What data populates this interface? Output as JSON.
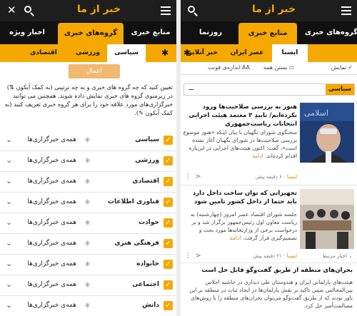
{
  "app": {
    "logo": "خبر از ما"
  },
  "left": {
    "tabs": [
      {
        "label": "منابع خبری"
      },
      {
        "label": "گروه‌های خبری",
        "active": true
      },
      {
        "label": "اخبار ویژه"
      }
    ],
    "subtabs": [
      {
        "label": "سیاسی"
      },
      {
        "label": "ورزشی"
      },
      {
        "label": "اقتصادی"
      }
    ],
    "apply_label": "اعمال",
    "instructions": "تعیین کنید که چه گروه های خبری و به چه ترتیبی (به کمک آیکون ⇅) در زیرمنوی گروه های خبری نمایش داده شوند. همچنین می توانید خبرگزاری‌های مورد علاقه خود را برای هر گروه خبری تعریف کنید (به کمک آیکون ✎).",
    "categories": [
      {
        "name": "سیاسی",
        "sources": "همه‌ی خبرگزاری‌ها"
      },
      {
        "name": "ورزشی",
        "sources": "همه‌ی خبرگزاری‌ها"
      },
      {
        "name": "اقتصادی",
        "sources": "همه‌ی خبرگزاری‌ها"
      },
      {
        "name": "فناوری اطلاعات",
        "sources": "همه‌ی خبرگزاری‌ها"
      },
      {
        "name": "حوادث",
        "sources": "همه‌ی خبرگزاری‌ها"
      },
      {
        "name": "فرهنگی هنری",
        "sources": "همه‌ی خبرگزاری‌ها"
      },
      {
        "name": "خانواده",
        "sources": "همه‌ی خبرگزاری‌ها"
      },
      {
        "name": "اجتماعی",
        "sources": "همه‌ی خبرگزاری‌ها"
      },
      {
        "name": "دانش",
        "sources": "همه‌ی خبرگزاری‌ها"
      }
    ]
  },
  "right": {
    "tabs": [
      {
        "label": "گروه‌های خبری"
      },
      {
        "label": "منابع خبری",
        "active": true
      },
      {
        "label": "روزنما"
      }
    ],
    "subtabs": [
      {
        "label": "ایسنا",
        "active": true
      },
      {
        "label": "عصر ایران"
      },
      {
        "label": "خبر آنلاین"
      }
    ],
    "toolbar": {
      "display": "نمایش",
      "close_all": "بستن همه",
      "font_size": "اندازه‌ی فونت"
    },
    "section": "سیاسی",
    "news": [
      {
        "title": "هنوز به بررسی صلاحیت‌ها ورود نکرده‌ایم/ تاییدِ ۳ معتمد هیئت اجرایی انتخابات ریاست‌جمهوری",
        "body": "سخنگوی شورای نگهبان با بیان اینکه «هنوز موضوع بررسی صلاحیت‌ها در شورای نگهبان آغاز نشده است»، گفت: اکنون هیئت‌های اجرایی در این‌باره اقدام کرده‌اند.",
        "more": "ادامه",
        "source": "ایسنا",
        "time": "۶ دقیقه پیش"
      },
      {
        "title": "تجهیزاتی که توان ساخت داخل دارد باید حتما از داخل کشور تامین شود",
        "body": "جلسه شورای اقتصاد عصر امروز (چهارشنبه) به ریاست معاون اول رئیس‌جمهور برگزار شد و بر درخواست برخی از وزارتخانه‌ها مورد بحث و تصمیم‌گیری قرار گرفت.",
        "more": "ادامه",
        "source": "ایسنا",
        "time": "۲۱ دقیقه پیش"
      }
    ],
    "related": "اخبار مرتبط",
    "wide_news": {
      "title": "بحران‌های منطقه از طریق گفت‌وگو قابل حل است",
      "body": "هیئت‌های پارلمانی ایران و هندوستان طی دیداری در حاشیه اجلاس بین‌المجالس ضمن تاکید بر نقش پارلمان‌ها در ایجاد ثبات در منطقه بر این باور بودند که از طریق گفت‌وگو می‌توان بحران‌های منطقه را با روش‌های مسالمت‌آمیز حل کرد."
    }
  },
  "colors": {
    "accent": "#f5a800",
    "dark": "#1e1e1e"
  }
}
